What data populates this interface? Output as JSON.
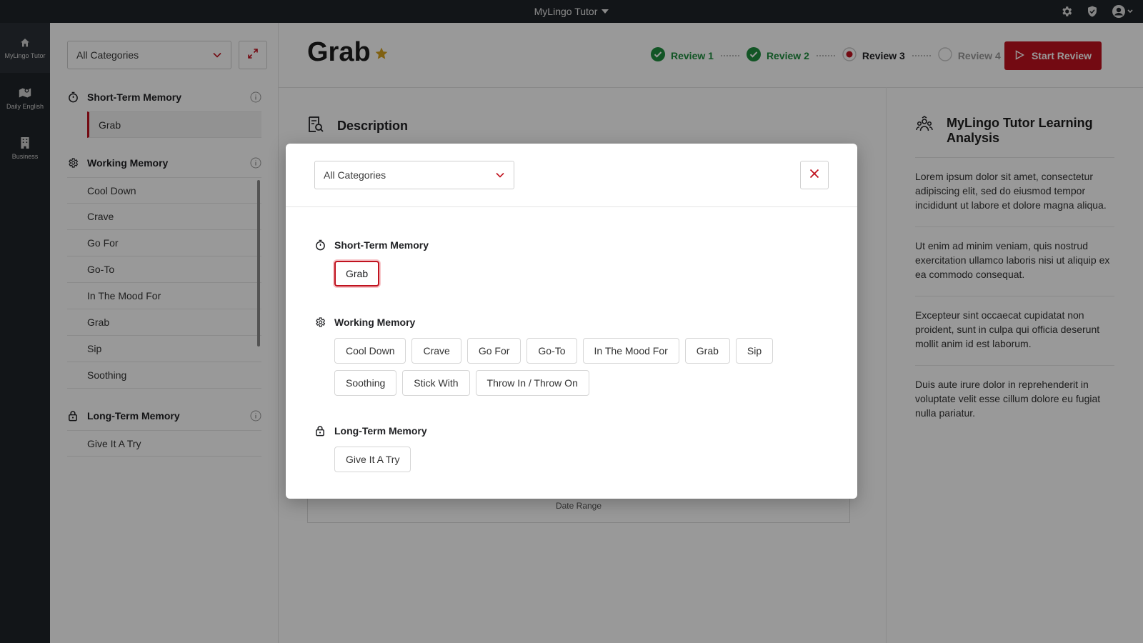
{
  "app": {
    "title": "MyLingo Tutor"
  },
  "rail": {
    "items": [
      {
        "label": "MyLingo Tutor",
        "icon": "home-icon"
      },
      {
        "label": "Daily English",
        "icon": "map-icon"
      },
      {
        "label": "Business",
        "icon": "building-icon"
      }
    ]
  },
  "sidebar": {
    "category_select": "All Categories",
    "sections": [
      {
        "title": "Short-Term Memory",
        "icon": "stopwatch-icon",
        "items": [
          "Grab"
        ],
        "selected": "Grab"
      },
      {
        "title": "Working Memory",
        "icon": "gear-icon",
        "items": [
          "Cool Down",
          "Crave",
          "Go For",
          "Go-To",
          "In The Mood For",
          "Grab",
          "Sip",
          "Soothing"
        ]
      },
      {
        "title": "Long-Term Memory",
        "icon": "lock-icon",
        "items": [
          "Give It A Try"
        ]
      }
    ]
  },
  "main": {
    "word": "Grab",
    "reviews": [
      {
        "label": "Review 1",
        "status": "done"
      },
      {
        "label": "Review 2",
        "status": "done"
      },
      {
        "label": "Review 3",
        "status": "current"
      },
      {
        "label": "Review 4",
        "status": "todo"
      }
    ],
    "start_review_label": "Start Review",
    "description_title": "Description",
    "date_range_label": "Date Range"
  },
  "analysis": {
    "title": "MyLingo Tutor Learning Analysis",
    "paragraphs": [
      "Lorem ipsum dolor sit amet, consectetur adipiscing elit, sed do eiusmod tempor incididunt ut labore et dolore magna aliqua.",
      "Ut enim ad minim veniam, quis nostrud exercitation ullamco laboris nisi ut aliquip ex ea commodo consequat.",
      "Excepteur sint occaecat cupidatat non proident, sunt in culpa qui officia deserunt mollit anim id est laborum.",
      "Duis aute irure dolor in reprehenderit in voluptate velit esse cillum dolore eu fugiat nulla pariatur."
    ]
  },
  "modal": {
    "category_select": "All Categories",
    "sections": [
      {
        "title": "Short-Term Memory",
        "chips": [
          "Grab"
        ],
        "active": "Grab"
      },
      {
        "title": "Working Memory",
        "chips": [
          "Cool Down",
          "Crave",
          "Go For",
          "Go-To",
          "In The Mood For",
          "Grab",
          "Sip",
          "Soothing",
          "Stick With",
          "Throw In / Throw On"
        ]
      },
      {
        "title": "Long-Term Memory",
        "chips": [
          "Give It A Try"
        ]
      }
    ]
  },
  "colors": {
    "brand_red": "#c0121e",
    "success_green": "#1e8e3e",
    "star_gold": "#d6a21e",
    "rail_dark": "#1f2328"
  }
}
